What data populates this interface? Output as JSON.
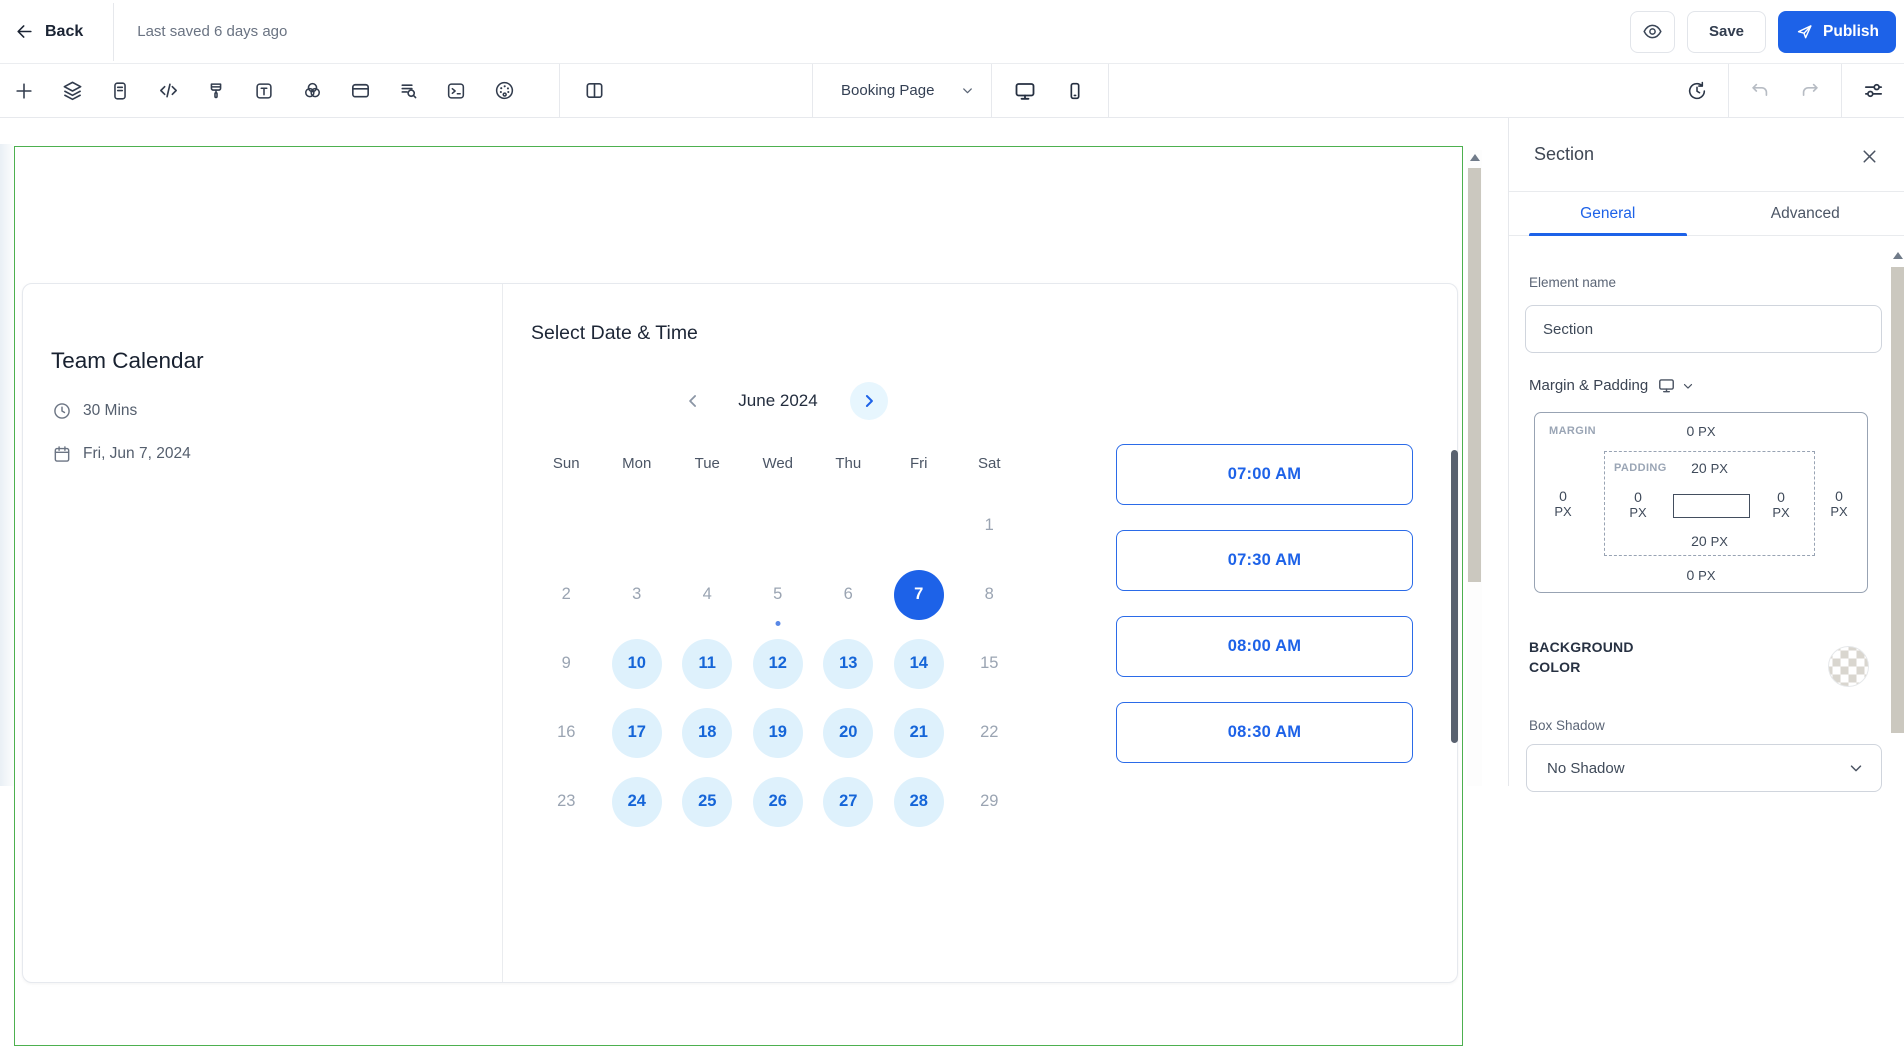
{
  "topbar": {
    "back_label": "Back",
    "last_saved": "Last saved 6 days ago",
    "save_label": "Save",
    "publish_label": "Publish",
    "icons": [
      "back-arrow-icon",
      "eye-icon",
      "send-icon"
    ]
  },
  "toolbar": {
    "icons": [
      "add-element-icon",
      "layers-icon",
      "form-icon",
      "code-icon",
      "paintbrush-icon",
      "text-icon",
      "blend-circles-icon",
      "card-icon",
      "doc-search-icon",
      "terminal-icon",
      "palette-icon",
      "column-split-icon",
      "desktop-icon",
      "mobile-icon",
      "history-icon",
      "undo-icon",
      "redo-icon",
      "settings-sliders-icon"
    ],
    "page_selector": {
      "value": "Booking Page"
    }
  },
  "canvas": {
    "widget": {
      "title": "Team Calendar",
      "duration": "30 Mins",
      "selected_date": "Fri, Jun 7, 2024",
      "heading": "Select Date & Time",
      "month_label": "June 2024",
      "icons": [
        "clock-icon",
        "calendar-icon",
        "chevron-left-icon",
        "chevron-right-icon"
      ],
      "weekdays": [
        "Sun",
        "Mon",
        "Tue",
        "Wed",
        "Thu",
        "Fri",
        "Sat"
      ],
      "weeks": [
        [
          {
            "d": "",
            "state": "empty"
          },
          {
            "d": "",
            "state": "empty"
          },
          {
            "d": "",
            "state": "empty"
          },
          {
            "d": "",
            "state": "empty"
          },
          {
            "d": "",
            "state": "empty"
          },
          {
            "d": "",
            "state": "empty"
          },
          {
            "d": "1",
            "state": "disabled"
          }
        ],
        [
          {
            "d": "2",
            "state": "disabled"
          },
          {
            "d": "3",
            "state": "disabled"
          },
          {
            "d": "4",
            "state": "disabled"
          },
          {
            "d": "5",
            "state": "disabled",
            "dot": true
          },
          {
            "d": "6",
            "state": "disabled"
          },
          {
            "d": "7",
            "state": "selected"
          },
          {
            "d": "8",
            "state": "disabled"
          }
        ],
        [
          {
            "d": "9",
            "state": "disabled"
          },
          {
            "d": "10",
            "state": "available"
          },
          {
            "d": "11",
            "state": "available"
          },
          {
            "d": "12",
            "state": "available"
          },
          {
            "d": "13",
            "state": "available"
          },
          {
            "d": "14",
            "state": "available"
          },
          {
            "d": "15",
            "state": "disabled"
          }
        ],
        [
          {
            "d": "16",
            "state": "disabled"
          },
          {
            "d": "17",
            "state": "available"
          },
          {
            "d": "18",
            "state": "available"
          },
          {
            "d": "19",
            "state": "available"
          },
          {
            "d": "20",
            "state": "available"
          },
          {
            "d": "21",
            "state": "available"
          },
          {
            "d": "22",
            "state": "disabled"
          }
        ],
        [
          {
            "d": "23",
            "state": "disabled"
          },
          {
            "d": "24",
            "state": "available"
          },
          {
            "d": "25",
            "state": "available"
          },
          {
            "d": "26",
            "state": "available"
          },
          {
            "d": "27",
            "state": "available"
          },
          {
            "d": "28",
            "state": "available"
          },
          {
            "d": "29",
            "state": "disabled"
          }
        ]
      ],
      "time_slots": [
        "07:00 AM",
        "07:30 AM",
        "08:00 AM",
        "08:30 AM"
      ]
    }
  },
  "panel": {
    "title": "Section",
    "icons": [
      "close-icon",
      "desktop-icon",
      "chevron-down-icon"
    ],
    "tabs": [
      {
        "label": "General",
        "active": true
      },
      {
        "label": "Advanced",
        "active": false
      }
    ],
    "element_name": {
      "label": "Element name",
      "value": "Section"
    },
    "margin_padding": {
      "label": "Margin & Padding",
      "margin_label": "MARGIN",
      "padding_label": "PADDING",
      "margin": {
        "top": {
          "value": "0",
          "unit": "PX"
        },
        "bottom": {
          "value": "0",
          "unit": "PX"
        },
        "left": {
          "value": "0",
          "unit": "PX"
        },
        "right": {
          "value": "0",
          "unit": "PX"
        }
      },
      "padding": {
        "top": {
          "value": "20",
          "unit": "PX"
        },
        "bottom": {
          "value": "20",
          "unit": "PX"
        },
        "left": {
          "value": "0",
          "unit": "PX"
        },
        "right": {
          "value": "0",
          "unit": "PX"
        }
      }
    },
    "background_color": {
      "label": "BACKGROUND COLOR"
    },
    "box_shadow": {
      "label": "Box Shadow",
      "value": "No Shadow"
    }
  },
  "colors": {
    "accent_blue": "#1d62e8",
    "available_day_bg": "#def1fc",
    "available_day_text": "#1565d8",
    "disabled_day_text": "#9aa4b2",
    "section_outline_green": "#4db04f",
    "scrollbar_thumb": "#cbc8bf",
    "widget_scrollbar": "#59616f"
  }
}
